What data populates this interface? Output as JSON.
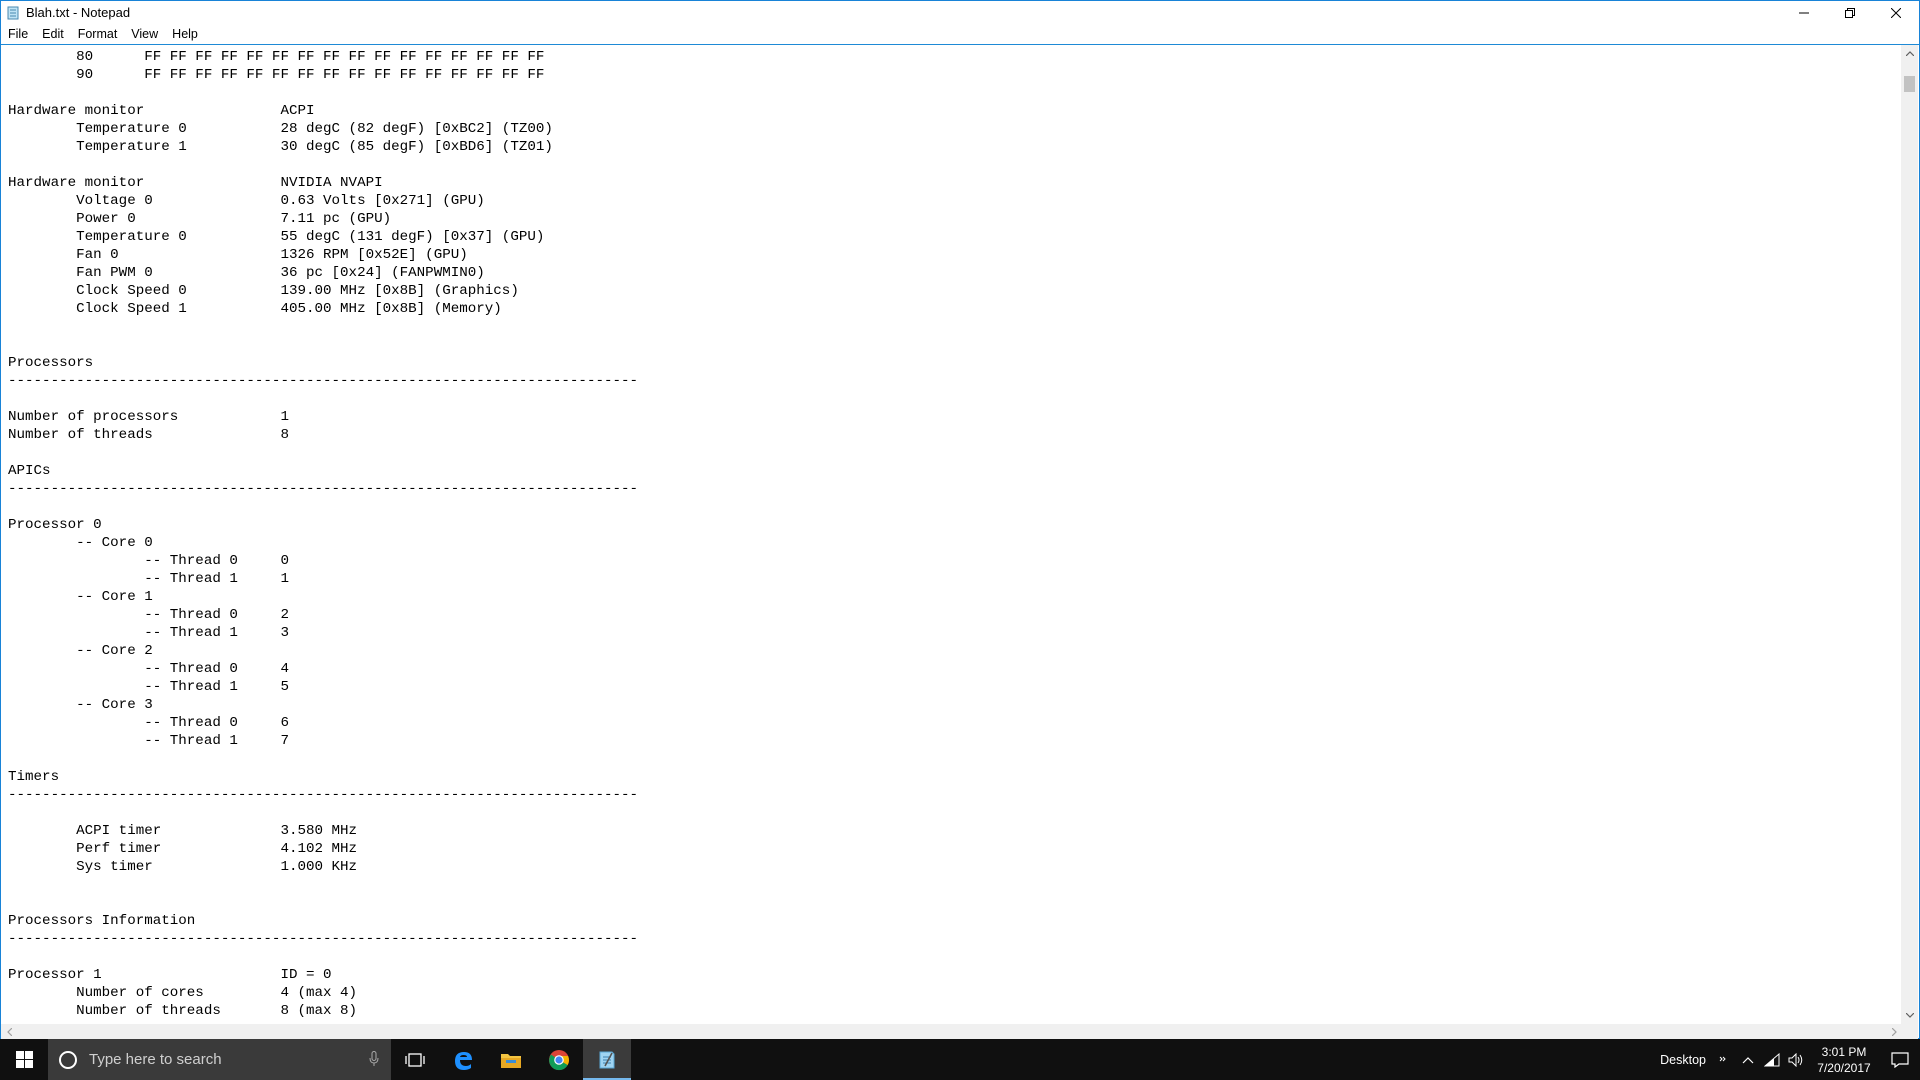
{
  "window": {
    "title": "Blah.txt - Notepad"
  },
  "menu": {
    "items": [
      "File",
      "Edit",
      "Format",
      "View",
      "Help"
    ]
  },
  "document": {
    "lines": [
      "        80      FF FF FF FF FF FF FF FF FF FF FF FF FF FF FF FF",
      "        90      FF FF FF FF FF FF FF FF FF FF FF FF FF FF FF FF",
      "",
      "Hardware monitor                ACPI",
      "        Temperature 0           28 degC (82 degF) [0xBC2] (TZ00)",
      "        Temperature 1           30 degC (85 degF) [0xBD6] (TZ01)",
      "",
      "Hardware monitor                NVIDIA NVAPI",
      "        Voltage 0               0.63 Volts [0x271] (GPU)",
      "        Power 0                 7.11 pc (GPU)",
      "        Temperature 0           55 degC (131 degF) [0x37] (GPU)",
      "        Fan 0                   1326 RPM [0x52E] (GPU)",
      "        Fan PWM 0               36 pc [0x24] (FANPWMIN0)",
      "        Clock Speed 0           139.00 MHz [0x8B] (Graphics)",
      "        Clock Speed 1           405.00 MHz [0x8B] (Memory)",
      "",
      "",
      "Processors",
      "--------------------------------------------------------------------------",
      "",
      "Number of processors            1",
      "Number of threads               8",
      "",
      "APICs",
      "--------------------------------------------------------------------------",
      "",
      "Processor 0",
      "        -- Core 0",
      "                -- Thread 0     0",
      "                -- Thread 1     1",
      "        -- Core 1",
      "                -- Thread 0     2",
      "                -- Thread 1     3",
      "        -- Core 2",
      "                -- Thread 0     4",
      "                -- Thread 1     5",
      "        -- Core 3",
      "                -- Thread 0     6",
      "                -- Thread 1     7",
      "",
      "Timers",
      "--------------------------------------------------------------------------",
      "",
      "        ACPI timer              3.580 MHz",
      "        Perf timer              4.102 MHz",
      "        Sys timer               1.000 KHz",
      "",
      "",
      "Processors Information",
      "--------------------------------------------------------------------------",
      "",
      "Processor 1                     ID = 0",
      "        Number of cores         4 (max 4)",
      "        Number of threads       8 (max 8)"
    ]
  },
  "taskbar": {
    "search_placeholder": "Type here to search",
    "desktop_label": "Desktop",
    "time": "3:01 PM",
    "date": "7/20/2017",
    "accent_color": "#76b9ed"
  }
}
